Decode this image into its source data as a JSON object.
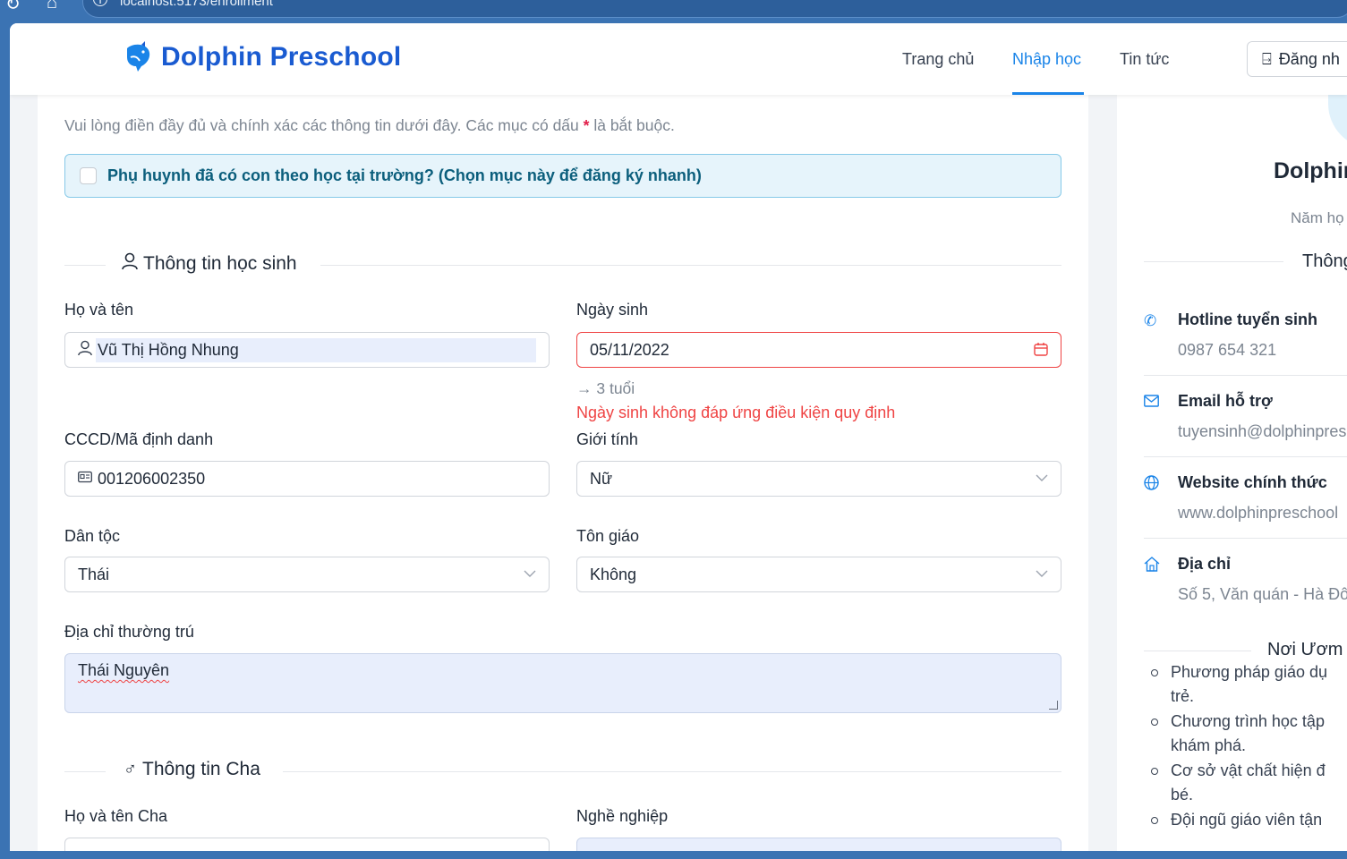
{
  "browser": {
    "url": "localhost:5173/enrollment"
  },
  "header": {
    "brand": "Dolphin Preschool",
    "nav": [
      {
        "label": "Trang chủ",
        "active": false
      },
      {
        "label": "Nhập học",
        "active": true
      },
      {
        "label": "Tin tức",
        "active": false
      }
    ],
    "login_label": "Đăng nh",
    "accent_color": "#1a84e8",
    "brand_color": "#1a5bd1"
  },
  "form": {
    "intro": "Vui lòng điền đầy đủ và chính xác các thông tin dưới đây. Các mục có dấu",
    "intro_required_mark": "*",
    "intro_suffix": "là bắt buộc.",
    "quick_register_label": "Phụ huynh đã có con theo học tại trường? (Chọn mục này để đăng ký nhanh)",
    "quick_register_checked": false,
    "student_section_title": "Thông tin học sinh",
    "full_name_label": "Họ và tên",
    "full_name_value": "Vũ Thị Hồng Nhung",
    "dob_label": "Ngày sinh",
    "dob_value": "05/11/2022",
    "age_text": "→ 3 tuổi",
    "dob_error": "Ngày sinh không đáp ứng điều kiện quy định",
    "id_label": "CCCD/Mã định danh",
    "id_value": "001206002350",
    "gender_label": "Giới tính",
    "gender_value": "Nữ",
    "ethnicity_label": "Dân tộc",
    "ethnicity_value": "Thái",
    "religion_label": "Tôn giáo",
    "religion_value": "Không",
    "address_label": "Địa chỉ thường trú",
    "address_value": "Thái Nguyên",
    "father_section_title": "Thông tin Cha",
    "father_name_label": "Họ và tên Cha",
    "father_job_label": "Nghề nghiệp"
  },
  "side": {
    "title": "Dolphin",
    "year": "Năm họ",
    "contact_section": "Thông",
    "contacts": [
      {
        "icon": "phone-icon",
        "title": "Hotline tuyển sinh",
        "value": "0987 654 321"
      },
      {
        "icon": "mail-icon",
        "title": "Email hỗ trợ",
        "value": "tuyensinh@dolphinpres"
      },
      {
        "icon": "globe-icon",
        "title": "Website chính thức",
        "value": "www.dolphinpreschool"
      },
      {
        "icon": "home-icon",
        "title": "Địa chỉ",
        "value": "Số 5, Văn quán - Hà Đô"
      }
    ],
    "features_section": "Nơi Ươm",
    "features": [
      "Phương pháp giáo dụ\ntrẻ.",
      "Chương trình học tập\nkhám phá.",
      "Cơ sở vật chất hiện đ\nbé.",
      "Đội ngũ giáo viên tận"
    ]
  }
}
